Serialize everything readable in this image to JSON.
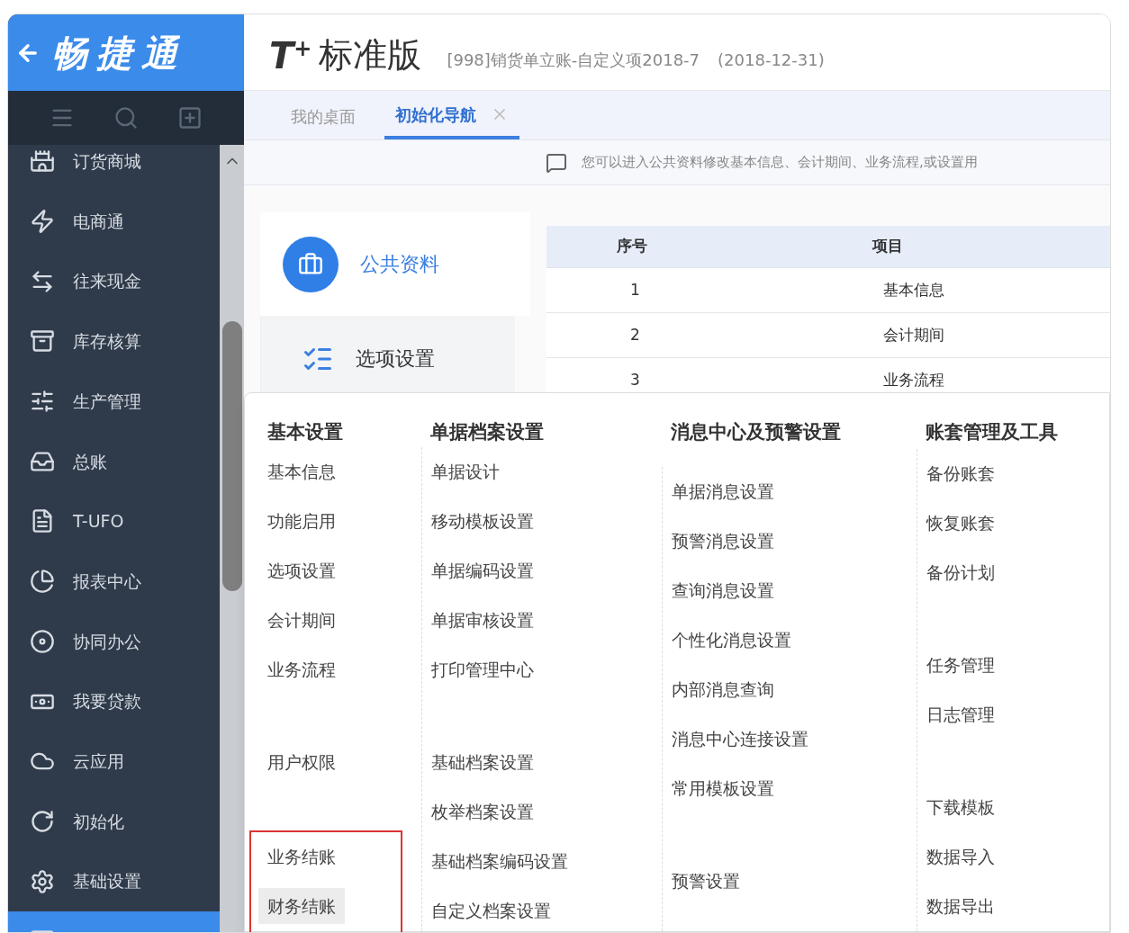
{
  "brand": {
    "logo": "畅捷通"
  },
  "header": {
    "product": "T",
    "product_sup": "+",
    "edition": "标准版",
    "account": "[998]销货单立账-自定义项2018-7",
    "date": "(2018-12-31)"
  },
  "sidebar": {
    "items": [
      {
        "label": "订货商城",
        "selected": false
      },
      {
        "label": "电商通",
        "selected": false
      },
      {
        "label": "往来现金",
        "selected": false
      },
      {
        "label": "库存核算",
        "selected": false
      },
      {
        "label": "生产管理",
        "selected": false
      },
      {
        "label": "总账",
        "selected": false
      },
      {
        "label": "T-UFO",
        "selected": false
      },
      {
        "label": "报表中心",
        "selected": false
      },
      {
        "label": "协同办公",
        "selected": false
      },
      {
        "label": "我要贷款",
        "selected": false
      },
      {
        "label": "云应用",
        "selected": false
      },
      {
        "label": "初始化",
        "selected": false
      },
      {
        "label": "基础设置",
        "selected": false
      },
      {
        "selected": true
      }
    ]
  },
  "tabs": [
    {
      "label": "我的桌面",
      "selected": false,
      "closable": false
    },
    {
      "label": "初始化导航",
      "selected": true,
      "closable": true
    }
  ],
  "notice": "您可以进入公共资料修改基本信息、会计期间、业务流程,或设置用",
  "nav_cards": [
    {
      "label": "公共资料",
      "selected": true
    },
    {
      "label": "选项设置",
      "selected": false
    }
  ],
  "table": {
    "columns": [
      "序号",
      "项目"
    ],
    "rows": [
      [
        "1",
        "基本信息"
      ],
      [
        "2",
        "会计期间"
      ],
      [
        "3",
        "业务流程"
      ]
    ]
  },
  "menu": {
    "columns": [
      {
        "title": "基本设置",
        "groups": [
          {
            "highlighted": false,
            "items": [
              {
                "label": "基本信息",
                "hovered": false
              },
              {
                "label": "功能启用",
                "hovered": false
              },
              {
                "label": "选项设置",
                "hovered": false
              },
              {
                "label": "会计期间",
                "hovered": false
              },
              {
                "label": "业务流程",
                "hovered": false
              }
            ]
          },
          {
            "highlighted": false,
            "items": [
              {
                "label": "用户权限",
                "hovered": false
              }
            ]
          },
          {
            "highlighted": true,
            "items": [
              {
                "label": "业务结账",
                "hovered": false
              },
              {
                "label": "财务结账",
                "hovered": true
              }
            ]
          }
        ]
      },
      {
        "title": "单据档案设置",
        "groups": [
          {
            "highlighted": false,
            "items": [
              {
                "label": "单据设计",
                "hovered": false
              },
              {
                "label": "移动模板设置",
                "hovered": false
              },
              {
                "label": "单据编码设置",
                "hovered": false
              },
              {
                "label": "单据审核设置",
                "hovered": false
              },
              {
                "label": "打印管理中心",
                "hovered": false
              }
            ]
          },
          {
            "highlighted": false,
            "items": [
              {
                "label": "基础档案设置",
                "hovered": false
              },
              {
                "label": "枚举档案设置",
                "hovered": false
              },
              {
                "label": "基础档案编码设置",
                "hovered": false
              },
              {
                "label": "自定义档案设置",
                "hovered": false
              }
            ]
          }
        ]
      },
      {
        "title": "消息中心及预警设置",
        "groups": [
          {
            "highlighted": false,
            "items": [
              {
                "label": "单据消息设置",
                "hovered": false
              },
              {
                "label": "预警消息设置",
                "hovered": false
              },
              {
                "label": "查询消息设置",
                "hovered": false
              },
              {
                "label": "个性化消息设置",
                "hovered": false
              },
              {
                "label": "内部消息查询",
                "hovered": false
              },
              {
                "label": "消息中心连接设置",
                "hovered": false
              },
              {
                "label": "常用模板设置",
                "hovered": false
              }
            ]
          },
          {
            "highlighted": false,
            "items": [
              {
                "label": "预警设置",
                "hovered": false
              }
            ]
          }
        ]
      },
      {
        "title": "账套管理及工具",
        "groups": [
          {
            "highlighted": false,
            "items": [
              {
                "label": "备份账套",
                "hovered": false
              },
              {
                "label": "恢复账套",
                "hovered": false
              },
              {
                "label": "备份计划",
                "hovered": false
              }
            ]
          },
          {
            "highlighted": false,
            "items": [
              {
                "label": "任务管理",
                "hovered": false
              },
              {
                "label": "日志管理",
                "hovered": false
              }
            ]
          },
          {
            "highlighted": false,
            "items": [
              {
                "label": "下载模板",
                "hovered": false
              },
              {
                "label": "数据导入",
                "hovered": false
              },
              {
                "label": "数据导出",
                "hovered": false
              }
            ]
          }
        ]
      }
    ]
  }
}
